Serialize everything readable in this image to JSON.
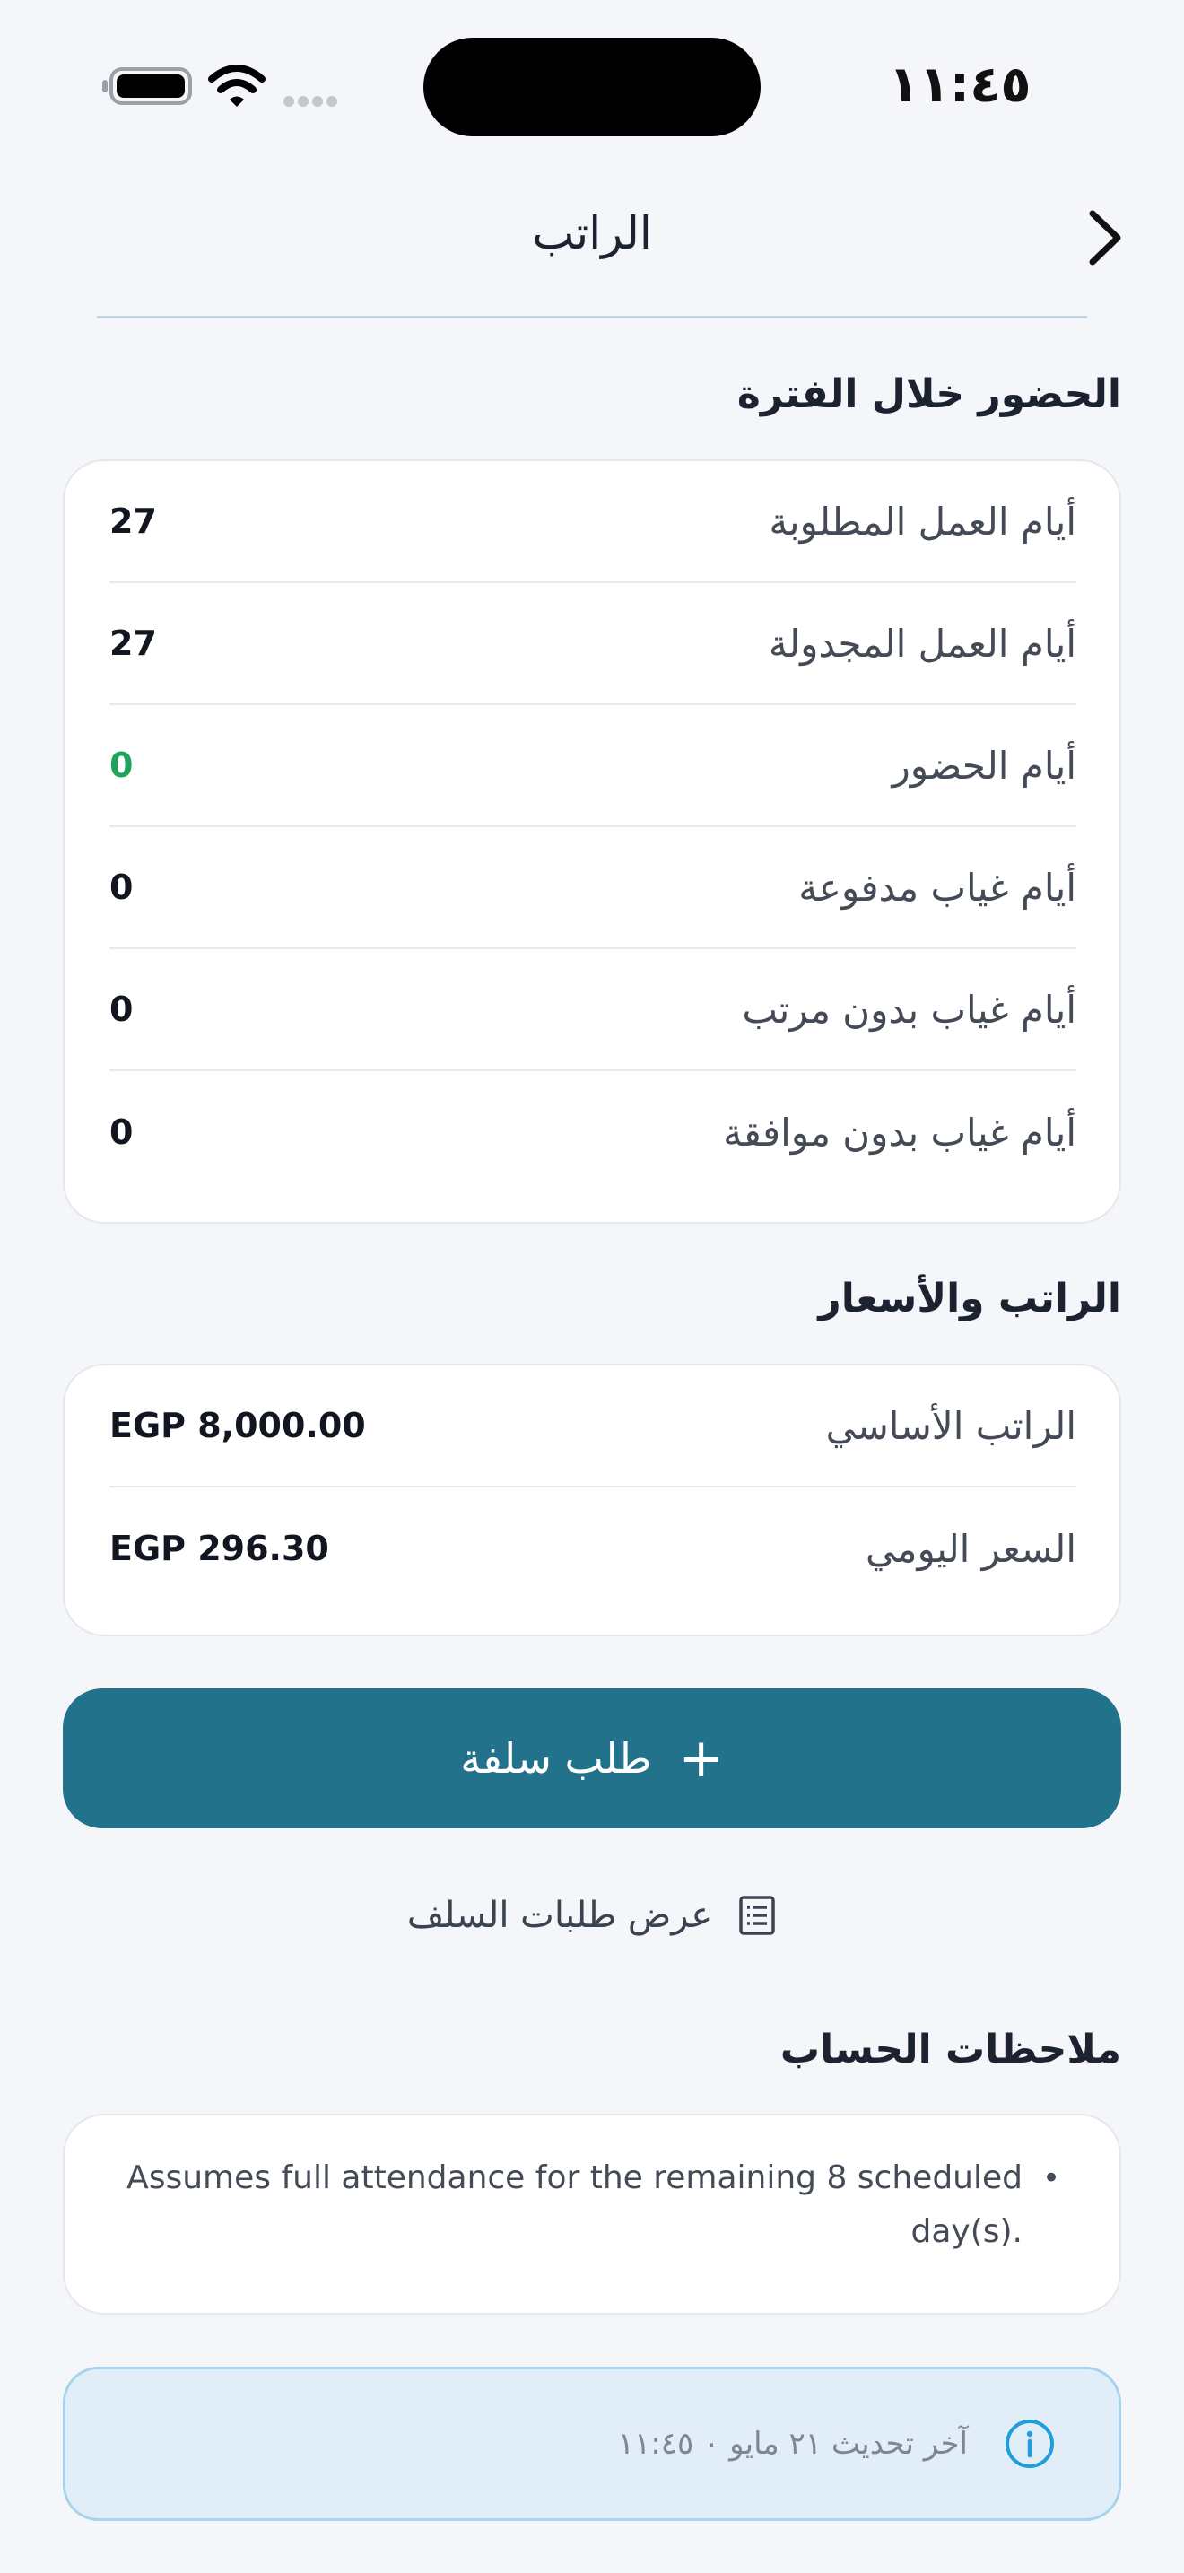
{
  "status_bar": {
    "time": "١١:٤٥"
  },
  "header": {
    "title": "الراتب"
  },
  "attendance": {
    "title": "الحضور خلال الفترة",
    "rows": [
      {
        "label": "أيام العمل المطلوبة",
        "value": "27"
      },
      {
        "label": "أيام العمل المجدولة",
        "value": "27"
      },
      {
        "label": "أيام الحضور",
        "value": "0"
      },
      {
        "label": "أيام غياب مدفوعة",
        "value": "0"
      },
      {
        "label": "أيام غياب بدون مرتب",
        "value": "0"
      },
      {
        "label": "أيام غياب بدون موافقة",
        "value": "0"
      }
    ]
  },
  "salary": {
    "title": "الراتب والأسعار",
    "rows": [
      {
        "label": "الراتب الأساسي",
        "value": "EGP 8,000.00"
      },
      {
        "label": "السعر اليومي",
        "value": "EGP 296.30"
      }
    ]
  },
  "actions": {
    "request_advance_label": "طلب سلفة",
    "view_requests_label": "عرض طلبات السلف"
  },
  "notes": {
    "title": "ملاحظات الحساب",
    "items": [
      "Assumes full attendance for the remaining 8 scheduled day(s)."
    ]
  },
  "info": {
    "text": "آخر تحديث ٢١ مايو ٠ ١١:٤٥"
  },
  "colors": {
    "primary": "#21728a",
    "positive": "#1fa35a",
    "info_background": "#e1eef7",
    "info_border": "#a8d3ee",
    "page_background": "#f4f6f9"
  },
  "icons": {
    "back": "chevron-right-icon",
    "add": "plus-icon",
    "requests": "document-list-icon",
    "info": "info-circle-icon"
  }
}
